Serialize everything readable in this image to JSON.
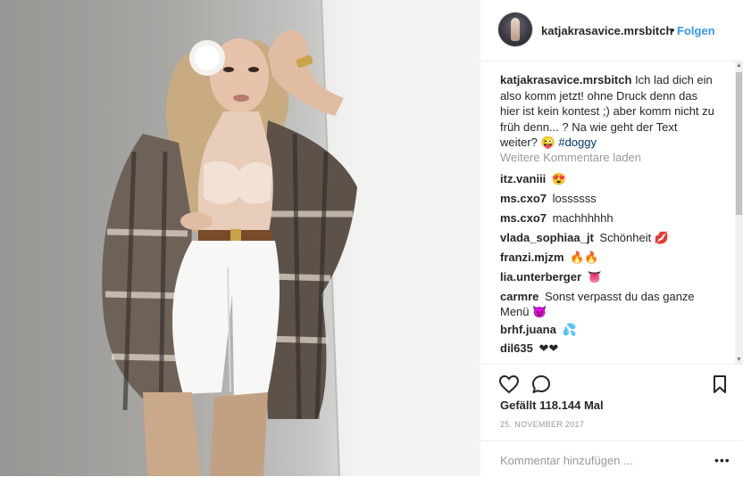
{
  "post": {
    "username": "katjakrasavice.mrsbitch",
    "separator": "•",
    "follow_label": "Folgen",
    "caption": {
      "username": "katjakrasavice.mrsbitch",
      "text": "Ich lad dich ein also komm jetzt! ohne Druck denn das hier ist kein kontest ;) aber komm nicht zu früh denn... ? Na wie geht der Text weiter? 😜",
      "hashtag": "#doggy"
    },
    "load_more_label": "Weitere Kommentare laden",
    "comments": [
      {
        "user": "itz.vaniii",
        "text": "",
        "emoji": "😍"
      },
      {
        "user": "ms.cxo7",
        "text": "lossssss",
        "emoji": ""
      },
      {
        "user": "ms.cxo7",
        "text": "machhhhhh",
        "emoji": ""
      },
      {
        "user": "vlada_sophiaa_jt",
        "text": "Schönheit",
        "emoji": "💋"
      },
      {
        "user": "franzi.mjzm",
        "text": "",
        "emoji": "🔥🔥"
      },
      {
        "user": "lia.unterberger",
        "text": "",
        "emoji": "👅"
      },
      {
        "user": "carmre",
        "text": "Sonst verpasst du das ganze Menü",
        "emoji": "😈"
      },
      {
        "user": "brhf.juana",
        "text": "",
        "emoji": "💦"
      },
      {
        "user": "dil635",
        "text": "",
        "emoji": "❤❤"
      }
    ],
    "likes_label": "Gefällt 118.144 Mal",
    "date": "25. NOVEMBER 2017",
    "comment_placeholder": "Kommentar hinzufügen ...",
    "more_options": "•••",
    "icons": [
      "heart-icon",
      "comment-icon",
      "bookmark-icon",
      "more-options-icon"
    ]
  }
}
